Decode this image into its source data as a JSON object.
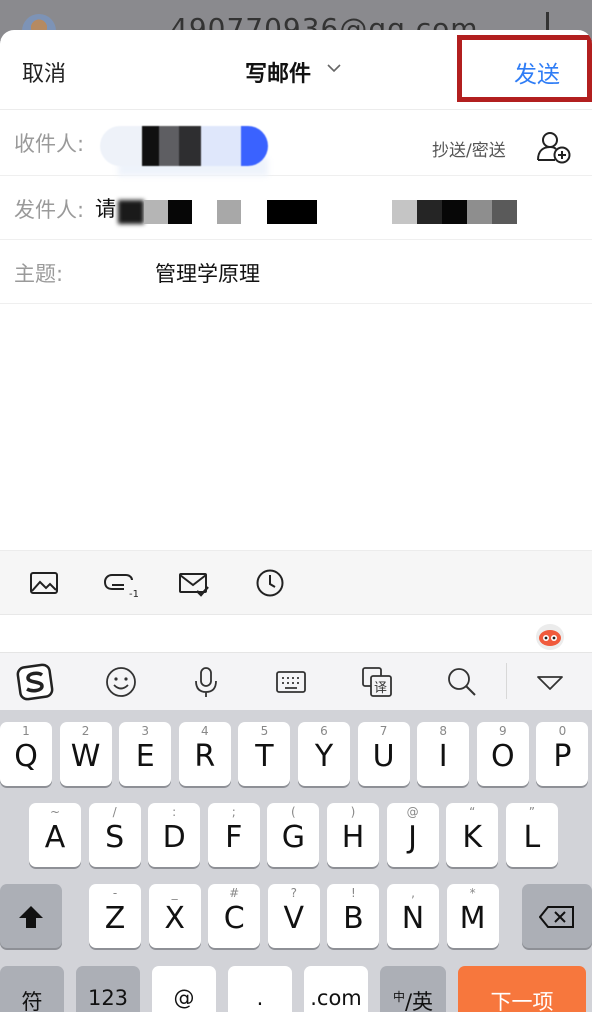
{
  "background": {
    "account": "490770936@qq.com"
  },
  "nav": {
    "cancel": "取消",
    "title": "写邮件",
    "send": "发送"
  },
  "fields": {
    "to_label": "收件人:",
    "cc_bcc": "抄送/密送",
    "from_label": "发件人:",
    "from_value": "请",
    "subject_label": "主题:",
    "subject_value": "管理学原理"
  },
  "toolbar": {
    "icons": [
      "image-icon",
      "attachment-icon",
      "mail-check-icon",
      "clock-icon"
    ]
  },
  "keyboard": {
    "row1": [
      {
        "k": "Q",
        "s": "1"
      },
      {
        "k": "W",
        "s": "2"
      },
      {
        "k": "E",
        "s": "3"
      },
      {
        "k": "R",
        "s": "4"
      },
      {
        "k": "T",
        "s": "5"
      },
      {
        "k": "Y",
        "s": "6"
      },
      {
        "k": "U",
        "s": "7"
      },
      {
        "k": "I",
        "s": "8"
      },
      {
        "k": "O",
        "s": "9"
      },
      {
        "k": "P",
        "s": "0"
      }
    ],
    "row2": [
      {
        "k": "A",
        "s": "~"
      },
      {
        "k": "S",
        "s": "/"
      },
      {
        "k": "D",
        "s": ":"
      },
      {
        "k": "F",
        "s": ";"
      },
      {
        "k": "G",
        "s": "("
      },
      {
        "k": "H",
        "s": ")"
      },
      {
        "k": "J",
        "s": "@"
      },
      {
        "k": "K",
        "s": "“"
      },
      {
        "k": "L",
        "s": "”"
      }
    ],
    "row3": [
      {
        "k": "Z",
        "s": "-"
      },
      {
        "k": "X",
        "s": "_"
      },
      {
        "k": "C",
        "s": "#"
      },
      {
        "k": "V",
        "s": "?"
      },
      {
        "k": "B",
        "s": "!"
      },
      {
        "k": "N",
        "s": ","
      },
      {
        "k": "M",
        "s": "*"
      }
    ],
    "bottom": {
      "symbols": "符",
      "numbers": "123",
      "at": "@",
      "dot": ".",
      "dotcom": ".com",
      "lang_zh": "中",
      "lang_en": "/英",
      "next": "下一项"
    }
  },
  "colors": {
    "accent": "#2f7df6",
    "highlight": "#b21f1f",
    "next_key": "#f7773d"
  }
}
